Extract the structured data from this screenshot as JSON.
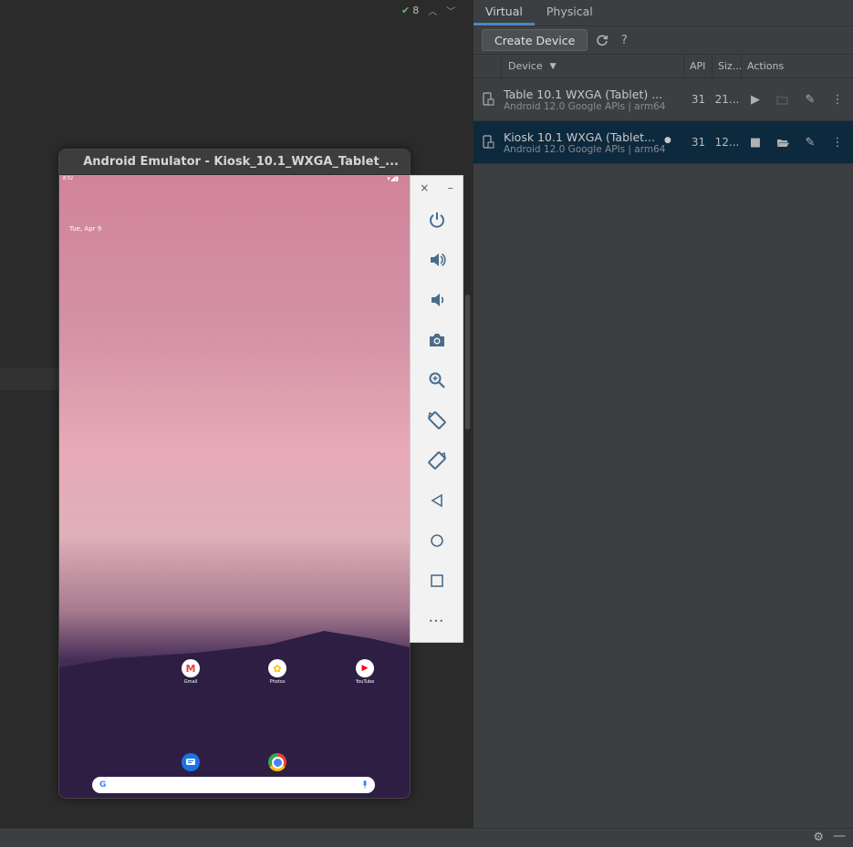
{
  "ide": {
    "inspection_count": "8"
  },
  "device_manager": {
    "tabs": [
      {
        "label": "Virtual",
        "active": true
      },
      {
        "label": "Physical",
        "active": false
      }
    ],
    "toolbar": {
      "create_label": "Create Device",
      "help_label": "?"
    },
    "columns": {
      "device": "Device",
      "api": "API",
      "size": "Siz...",
      "actions": "Actions"
    },
    "devices": [
      {
        "name": "Table 10.1  WXGA (Tablet) ...",
        "subtitle": "Android 12.0 Google APIs | arm64",
        "api": "31",
        "size": "21...",
        "running": false,
        "selected": false
      },
      {
        "name": "Kiosk 10.1  WXGA (Tablet...",
        "subtitle": "Android 12.0 Google APIs | arm64",
        "api": "31",
        "size": "12...",
        "running": true,
        "selected": true
      }
    ]
  },
  "emulator": {
    "title": "Android Emulator - Kiosk_10.1_WXGA_Tablet_...",
    "status_time": "8:52",
    "date": "Tue, Apr 9",
    "apps": [
      {
        "label": "Gmail",
        "glyph": "M",
        "color": "#ea4335"
      },
      {
        "label": "Photos",
        "glyph": "✿",
        "color": "#fbbc04"
      },
      {
        "label": "YouTube",
        "glyph": "▶",
        "color": "#ff0000"
      }
    ],
    "dock": [
      {
        "name": "messages",
        "color": "#1a73e8"
      },
      {
        "name": "chrome",
        "color": "#4285f4"
      }
    ],
    "search_glyph": "G"
  },
  "emulator_toolbar": {
    "close_glyph": "×",
    "minimize_glyph": "–",
    "more_glyph": "•••"
  }
}
